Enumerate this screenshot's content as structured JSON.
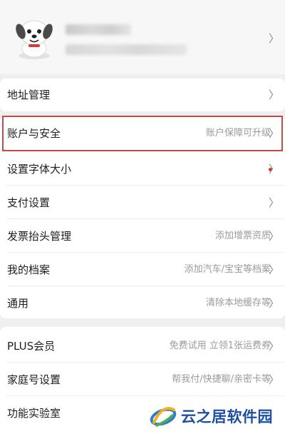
{
  "profile": {
    "avatar_icon": "jd-dog-mascot-icon",
    "chevron": "〉"
  },
  "menu": {
    "address": {
      "label": "地址管理",
      "chevron": "〉"
    },
    "account_security": {
      "label": "账户与安全",
      "value": "账户保障可升级",
      "chevron": "〉"
    },
    "font_size": {
      "label": "设置字体大小",
      "chevron": "〉"
    },
    "payment": {
      "label": "支付设置",
      "chevron": "〉"
    },
    "invoice": {
      "label": "发票抬头管理",
      "value": "添加增票资质",
      "chevron": "〉"
    },
    "archive": {
      "label": "我的档案",
      "value": "添加汽车/宝宝等档案",
      "chevron": "〉"
    },
    "general": {
      "label": "通用",
      "value": "清除本地缓存等",
      "chevron": "〉"
    },
    "plus": {
      "label": "PLUS会员",
      "value": "免费试用 立领1张运费券",
      "chevron": "〉"
    },
    "family": {
      "label": "家庭号设置",
      "value": "帮我付/快捷聊/亲密卡等",
      "chevron": "〉"
    },
    "lab": {
      "label": "功能实验室"
    }
  },
  "colors": {
    "highlight_border": "#c44a4a",
    "notification_dot": "#d9342b",
    "watermark_text": "#1e4fa3"
  },
  "watermark": {
    "text": "云之居软件园",
    "icon": "swirl-logo-icon"
  }
}
